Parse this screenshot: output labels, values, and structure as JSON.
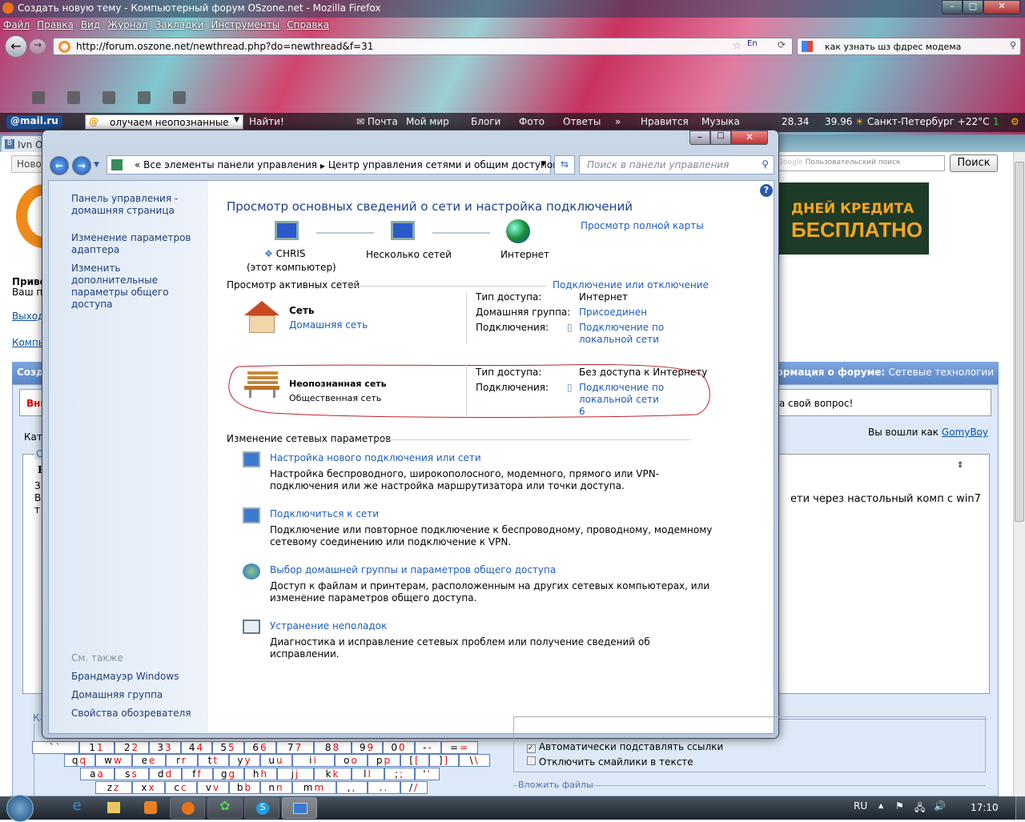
{
  "browser": {
    "title": "Создать новую тему - Компьютерный форум OSzone.net - Mozilla Firefox",
    "menu": [
      "Файл",
      "Правка",
      "Вид",
      "Журнал",
      "Закладки",
      "Инструменты",
      "Справка"
    ],
    "url": "http://forum.oszone.net/newthread.php?do=newthread&f=31",
    "lang": "En",
    "search": "как узнать шз фдрес модема",
    "tab": "Ivn O"
  },
  "mailru": {
    "logo": "@mail.ru",
    "search": "олучаем неопознанные се",
    "find": "Найти!",
    "items": [
      "Почта",
      "Мой мир",
      "Блоги",
      "Фото",
      "Ответы",
      "»",
      "Нравится",
      "Музыка",
      "28.34",
      "39.96",
      "Санкт-Петербург +22°C",
      "1"
    ]
  },
  "forum": {
    "greeting": "Приве",
    "greeting2": "Ваш п",
    "logout": "Выход",
    "comp": "Компь",
    "create": "Созд",
    "warn": "Вни",
    "cat": "Кате",
    "fs": "Со",
    "b": "В",
    "t1": "З",
    "t2": "В",
    "t3": "т",
    "google_placeholder": "Пользовательский поиск",
    "google_btn": "Поиск",
    "google_logo": "Google",
    "ad_line1": "ДНЕЙ КРЕДИТА",
    "ad_line2": "БЕСПЛАТНО",
    "info_label": "нформация о форуме:",
    "info_value": "Сетевые технологии",
    "notice": "на свой вопрос!",
    "logged_as": "Вы вошли как",
    "user": "GomyBoy",
    "post_text": "ети через настольный комп с win7",
    "opt1": "Автоматически подставлять ссылки",
    "opt2": "Отключить смайлики в тексте",
    "attach": "Вложить файлы",
    "kb_legend": "К"
  },
  "keyboard": [
    [
      [
        "`",
        "`"
      ],
      [
        "1",
        "1"
      ],
      [
        "2",
        "2"
      ],
      [
        "3",
        "3"
      ],
      [
        "4",
        "4"
      ],
      [
        "5",
        "5"
      ],
      [
        "6",
        "6"
      ],
      [
        "7",
        "7"
      ],
      [
        "8",
        "8"
      ],
      [
        "9",
        "9"
      ],
      [
        "0",
        "0"
      ],
      [
        "-",
        "-"
      ],
      [
        "=",
        "="
      ]
    ],
    [
      [
        "q",
        "q"
      ],
      [
        "w",
        "w"
      ],
      [
        "e",
        "e"
      ],
      [
        "r",
        "r"
      ],
      [
        "t",
        "t"
      ],
      [
        "y",
        "y"
      ],
      [
        "u",
        "u"
      ],
      [
        "i",
        "i"
      ],
      [
        "o",
        "o"
      ],
      [
        "p",
        "p"
      ],
      [
        "[",
        "["
      ],
      [
        "]",
        "]"
      ],
      [
        "\\",
        "\\"
      ]
    ],
    [
      [
        "a",
        "a"
      ],
      [
        "s",
        "s"
      ],
      [
        "d",
        "d"
      ],
      [
        "f",
        "f"
      ],
      [
        "g",
        "g"
      ],
      [
        "h",
        "h"
      ],
      [
        "j",
        "j"
      ],
      [
        "k",
        "k"
      ],
      [
        "l",
        "l"
      ],
      [
        ";",
        ";"
      ],
      [
        "'",
        "'"
      ]
    ],
    [
      [
        "z",
        "z"
      ],
      [
        "x",
        "x"
      ],
      [
        "c",
        "c"
      ],
      [
        "v",
        "v"
      ],
      [
        "b",
        "b"
      ],
      [
        "n",
        "n"
      ],
      [
        "m",
        "m"
      ],
      [
        ",",
        ","
      ],
      [
        ".",
        "."
      ],
      [
        "/",
        "/"
      ]
    ]
  ],
  "dialog": {
    "breadcrumb": [
      "«",
      "Все элементы панели управления",
      "Центр управления сетями и общим доступом"
    ],
    "search_placeholder": "Поиск в панели управления",
    "left": {
      "home": "Панель управления - домашняя страница",
      "adapter": "Изменение параметров адаптера",
      "sharing": "Изменить дополнительные параметры общего доступа",
      "see_also": "См. также",
      "links": [
        "Брандмауэр Windows",
        "Домашняя группа",
        "Свойства обозревателя"
      ]
    },
    "heading": "Просмотр основных сведений о сети и настройка подключений",
    "full_map": "Просмотр полной карты",
    "map": {
      "computer": "CHRIS",
      "computer_sub": "(этот компьютер)",
      "middle": "Несколько сетей",
      "internet": "Интернет"
    },
    "active_title": "Просмотр активных сетей",
    "connect_link": "Подключение или отключение",
    "networks": [
      {
        "name": "Сеть",
        "type": "Домашняя сеть",
        "access_label": "Тип доступа:",
        "access": "Интернет",
        "homegroup_label": "Домашняя группа:",
        "homegroup": "Присоединен",
        "conn_label": "Подключения:",
        "conn": "Подключение по локальной сети"
      },
      {
        "name": "Неопознанная сеть",
        "type": "Общественная сеть",
        "access_label": "Тип доступа:",
        "access": "Без доступа к Интернету",
        "conn_label": "Подключения:",
        "conn": "Подключение по локальной сети 6"
      }
    ],
    "change_title": "Изменение сетевых параметров",
    "tasks": [
      {
        "title": "Настройка нового подключения или сети",
        "desc": "Настройка беспроводного, широкополосного, модемного, прямого или VPN-подключения или же настройка маршрутизатора или точки доступа."
      },
      {
        "title": "Подключиться к сети",
        "desc": "Подключение или повторное подключение к беспроводному, проводному, модемному сетевому соединению или подключение к VPN."
      },
      {
        "title": "Выбор домашней группы и параметров общего доступа",
        "desc": "Доступ к файлам и принтерам, расположенным на других сетевых компьютерах, или изменение параметров общего доступа."
      },
      {
        "title": "Устранение неполадок",
        "desc": "Диагностика и исправление сетевых проблем или получение сведений об исправлении."
      }
    ]
  },
  "taskbar": {
    "lang": "RU",
    "time": "17:10"
  },
  "colors": {
    "link": "#1e5ebc",
    "annotation": "#c0202a"
  }
}
